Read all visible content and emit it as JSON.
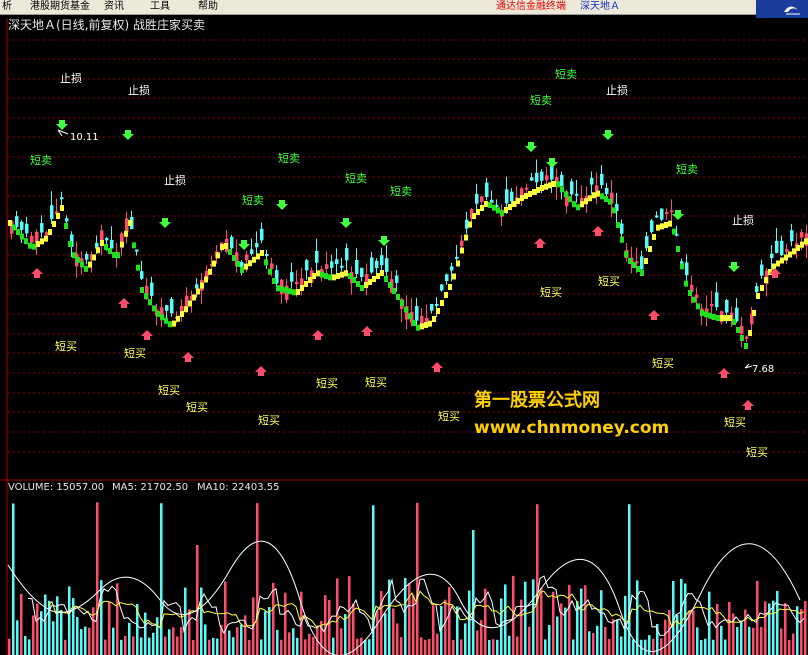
{
  "menubar": {
    "items": [
      "析",
      "港股期货基金",
      "资讯",
      "工具",
      "帮助"
    ],
    "app_name": "通达信金融终端",
    "stock_name": "深天地Ａ"
  },
  "chart_title": "深天地Ａ(日线,前复权) 战胜庄家买卖",
  "annotations": {
    "stop_loss": "止损",
    "short_sell": "短卖",
    "short_buy": "短买",
    "high_price": "10.11",
    "low_price": "7.68"
  },
  "volume_panel": {
    "volume": "VOLUME: 15057.00",
    "ma5": "MA5: 21702.50",
    "ma10": "MA10: 22403.55"
  },
  "watermark": {
    "line1": "第一股票公式网",
    "line2": "www.chnmoney.com"
  },
  "colors": {
    "background": "#000000",
    "up": "#ff4c6a",
    "down": "#54fcfc",
    "trend_up": "#ffff40",
    "trend_down": "#20e020",
    "grid": "#8b0000",
    "short_sell": "#40ff40",
    "short_buy": "#ffff60",
    "stop_loss": "#ffffff",
    "watermark": "#ffd000"
  },
  "chart_data": {
    "type": "candlestick",
    "price_high": 10.11,
    "price_low": 7.68,
    "candles_visible": "approx. 160 daily bars",
    "volume_ma_periods": [
      5,
      10
    ]
  }
}
